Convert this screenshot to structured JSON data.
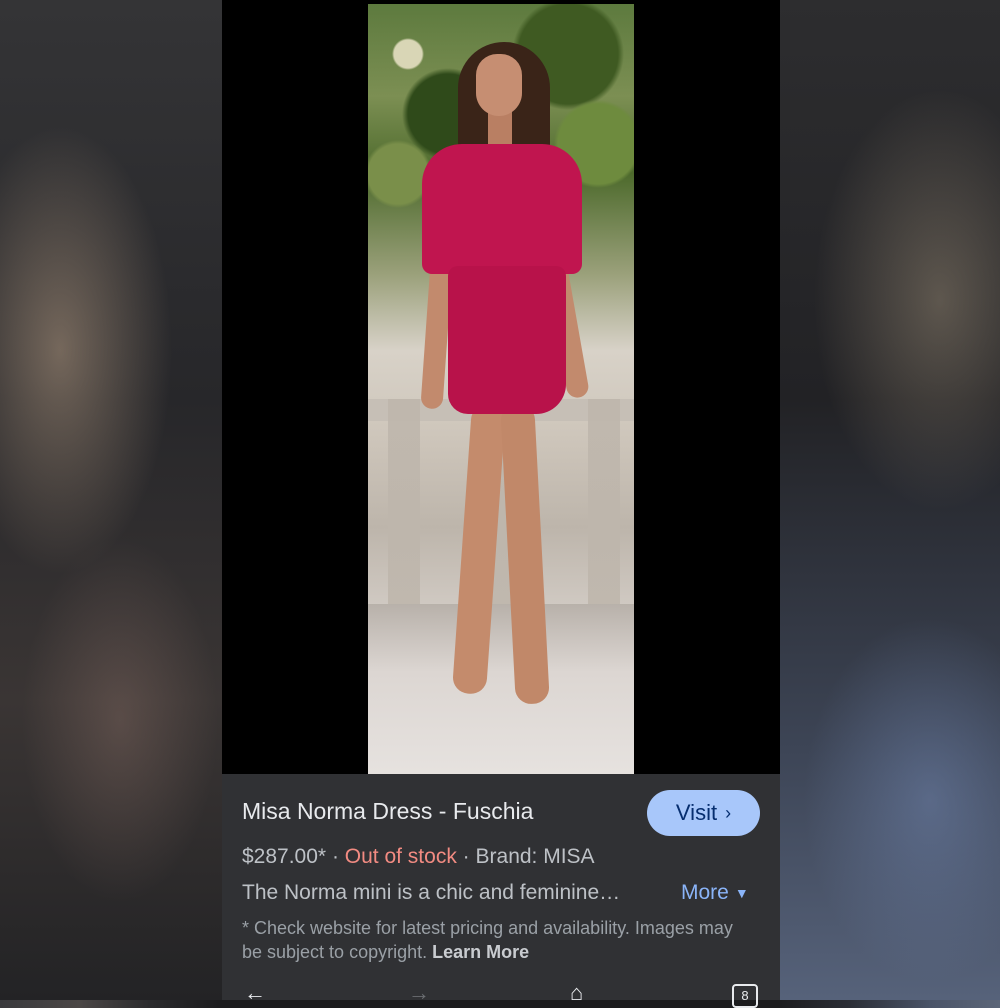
{
  "product": {
    "title": "Misa Norma Dress - Fuschia",
    "visit_label": "Visit",
    "price": "$287.00*",
    "separator": "·",
    "stock_status": "Out of stock",
    "brand": "Brand: MISA",
    "description": "The Norma mini is a chic and feminine…",
    "more_label": "More"
  },
  "disclaimer": {
    "text": "* Check website for latest pricing and availability. Images may be subject to copyright.",
    "link_label": "Learn More"
  },
  "navbar": {
    "tab_count": "8"
  },
  "colors": {
    "accent_button": "#a8c7fa",
    "out_of_stock": "#f28b82",
    "link": "#8ab4f8",
    "dress": "#c0154f"
  }
}
